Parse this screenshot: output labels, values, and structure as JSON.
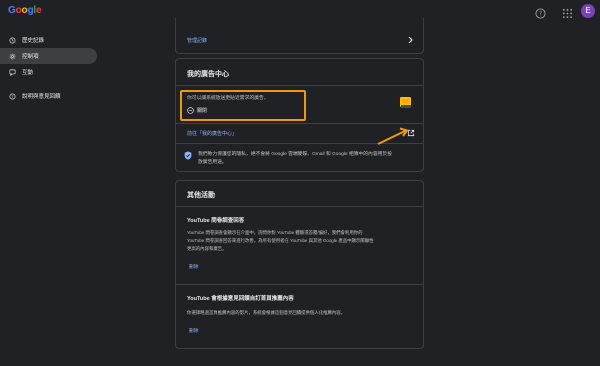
{
  "header": {
    "logo_letters": [
      "G",
      "o",
      "o",
      "g",
      "l",
      "e"
    ],
    "help_icon": "help-circle-icon",
    "apps_icon": "apps-grid-icon",
    "avatar_letter": "E",
    "avatar_color": "#7c3fbd"
  },
  "sidebar": {
    "items": [
      {
        "label": "歷史記錄",
        "icon": "history-icon"
      },
      {
        "label": "控制項",
        "icon": "gear-icon"
      },
      {
        "label": "互動",
        "icon": "feedback-icon"
      },
      {
        "label": "說明與意見回饋",
        "icon": "help-circle-icon"
      }
    ]
  },
  "manage_card": {
    "link_label": "管理記錄"
  },
  "my_ad_center": {
    "title": "我的廣告中心",
    "description": "你可以讓系統放送更貼近需求的廣告。",
    "status_label": "關閉",
    "goto_link": "前往「我的廣告中心」",
    "privacy_note_line1": "我們致力保護您的隱私，絕不會將 Google 雲端硬碟、Gmail 和 Google 相簿中的內容用於投",
    "privacy_note_line2": "放廣告用途。"
  },
  "other_activity": {
    "title": "其他活動",
    "youtube_surveys": {
      "title": "YouTube 問卷調查回答",
      "line1": "YouTube 問卷調查會顯示在介面中，詢問你對 YouTube 體驗或答覆/偏好，我們會利用你的",
      "line2": "YouTube 問卷調查回答來進行改善，為所有使用者在 YouTube 與其他 Google 產品中顯示關聯性",
      "line3": "更高的內容和廣告。",
      "action": "刪除"
    },
    "youtube_feedback": {
      "title": "YouTube 會根據意見回饋自訂首頁推薦內容",
      "line1": "你選擇略過首頁推薦內容的影片，系統會根據這個意見回饋提供個人化推薦內容。",
      "action": "刪除"
    }
  },
  "colors": {
    "accent_link": "#8ab4f8",
    "highlight": "#f29900"
  }
}
